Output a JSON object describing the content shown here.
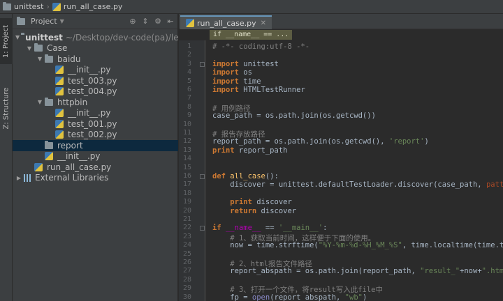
{
  "topbar": {
    "project": "unittest",
    "file": "run_all_case.py"
  },
  "toolstrip": {
    "project_tab": "1: Project",
    "structure_tab": "Z: Structure"
  },
  "project_panel": {
    "title": "Project",
    "tree": [
      {
        "label": "unittest",
        "path": "~/Desktop/dev-code(pa)/lear",
        "type": "folder",
        "depth": 0,
        "expanded": true,
        "bold": true
      },
      {
        "label": "Case",
        "type": "folder",
        "depth": 1,
        "expanded": true
      },
      {
        "label": "baidu",
        "type": "folder",
        "depth": 2,
        "expanded": true
      },
      {
        "label": "__init__.py",
        "type": "py",
        "depth": 3
      },
      {
        "label": "test_003.py",
        "type": "py",
        "depth": 3
      },
      {
        "label": "test_004.py",
        "type": "py",
        "depth": 3
      },
      {
        "label": "httpbin",
        "type": "folder",
        "depth": 2,
        "expanded": true
      },
      {
        "label": "__init__.py",
        "type": "py",
        "depth": 3
      },
      {
        "label": "test_001.py",
        "type": "py",
        "depth": 3
      },
      {
        "label": "test_002.py",
        "type": "py",
        "depth": 3
      },
      {
        "label": "report",
        "type": "folder",
        "depth": 2,
        "selected": true
      },
      {
        "label": "__init__.py",
        "type": "py",
        "depth": 2
      },
      {
        "label": "run_all_case.py",
        "type": "py",
        "depth": 1
      },
      {
        "label": "External Libraries",
        "type": "lib",
        "depth": 0,
        "expanded": false
      }
    ]
  },
  "editor": {
    "tab_label": "run_all_case.py",
    "scope_crumb": "if __name__ == ...",
    "line_numbers": [
      "1",
      "2",
      "3",
      "4",
      "5",
      "6",
      "7",
      "8",
      "9",
      "10",
      "11",
      "12",
      "13",
      "14",
      "15",
      "16",
      "17",
      "18",
      "19",
      "20",
      "21",
      "22",
      "23",
      "24",
      "25",
      "26",
      "27",
      "28",
      "29",
      "30"
    ],
    "lines": [
      [
        [
          "c-comment",
          "# -*- coding:utf-8 -*-"
        ]
      ],
      [],
      [
        [
          "c-kw",
          "import"
        ],
        [
          "c-plain",
          " unittest"
        ]
      ],
      [
        [
          "c-kw",
          "import"
        ],
        [
          "c-plain",
          " os"
        ]
      ],
      [
        [
          "c-kw",
          "import"
        ],
        [
          "c-plain",
          " time"
        ]
      ],
      [
        [
          "c-kw",
          "import"
        ],
        [
          "c-plain",
          " HTMLTestRunner"
        ]
      ],
      [],
      [
        [
          "c-comment",
          "# 用例路径"
        ]
      ],
      [
        [
          "c-plain",
          "case_path = os.path.join(os.getcwd())"
        ]
      ],
      [],
      [
        [
          "c-comment",
          "# 报告存放路径"
        ]
      ],
      [
        [
          "c-plain",
          "report_path = os.path.join(os.getcwd(), "
        ],
        [
          "c-str",
          "'report'"
        ],
        [
          "c-plain",
          ")"
        ]
      ],
      [
        [
          "c-kw",
          "print"
        ],
        [
          "c-plain",
          " report_path"
        ]
      ],
      [],
      [],
      [
        [
          "c-kw",
          "def"
        ],
        [
          "c-plain",
          " "
        ],
        [
          "c-fn",
          "all_case"
        ],
        [
          "c-plain",
          "():"
        ]
      ],
      [
        [
          "c-plain",
          "    discover = unittest.defaultTestLoader.discover(case_path, "
        ],
        [
          "c-param",
          "pattern"
        ],
        [
          "c-plain",
          "="
        ],
        [
          "c-str",
          "\"t"
        ]
      ],
      [],
      [
        [
          "c-plain",
          "    "
        ],
        [
          "c-kw",
          "print"
        ],
        [
          "c-plain",
          " discover"
        ]
      ],
      [
        [
          "c-plain",
          "    "
        ],
        [
          "c-kw",
          "return"
        ],
        [
          "c-plain",
          " discover"
        ]
      ],
      [],
      [
        [
          "c-kw",
          "if"
        ],
        [
          "c-plain",
          " "
        ],
        [
          "c-magic",
          "__name__"
        ],
        [
          "c-plain",
          " == "
        ],
        [
          "c-str",
          "'__main__'"
        ],
        [
          "c-plain",
          ":"
        ]
      ],
      [
        [
          "c-plain",
          "    "
        ],
        [
          "c-comment",
          "# 1、获取当前时间，这样便于下面的使用。"
        ]
      ],
      [
        [
          "c-plain",
          "    now = time.strftime("
        ],
        [
          "c-str",
          "\"%Y-%m-%d-%H_%M_%S\""
        ],
        [
          "c-plain",
          ", time.localtime(time.time())"
        ]
      ],
      [],
      [
        [
          "c-plain",
          "    "
        ],
        [
          "c-comment",
          "# 2、html报告文件路径"
        ]
      ],
      [
        [
          "c-plain",
          "    report_abspath = os.path.join(report_path, "
        ],
        [
          "c-str",
          "\"result_\""
        ],
        [
          "c-plain",
          "+now+"
        ],
        [
          "c-str",
          "\".html\""
        ],
        [
          "c-plain",
          ")"
        ]
      ],
      [],
      [
        [
          "c-plain",
          "    "
        ],
        [
          "c-comment",
          "# 3、打开一个文件，将result写入此file中"
        ]
      ],
      [
        [
          "c-plain",
          "    fp = "
        ],
        [
          "c-builtin",
          "open"
        ],
        [
          "c-plain",
          "(report_abspath, "
        ],
        [
          "c-str",
          "\"wb\""
        ],
        [
          "c-plain",
          ")"
        ]
      ]
    ],
    "fold_lines": [
      3,
      16,
      22
    ]
  },
  "colors": {
    "keyword": "#cc7832",
    "string": "#6a8759",
    "comment": "#808080",
    "function": "#ffc66d",
    "param": "#aa4926",
    "selection": "#0d293e"
  }
}
